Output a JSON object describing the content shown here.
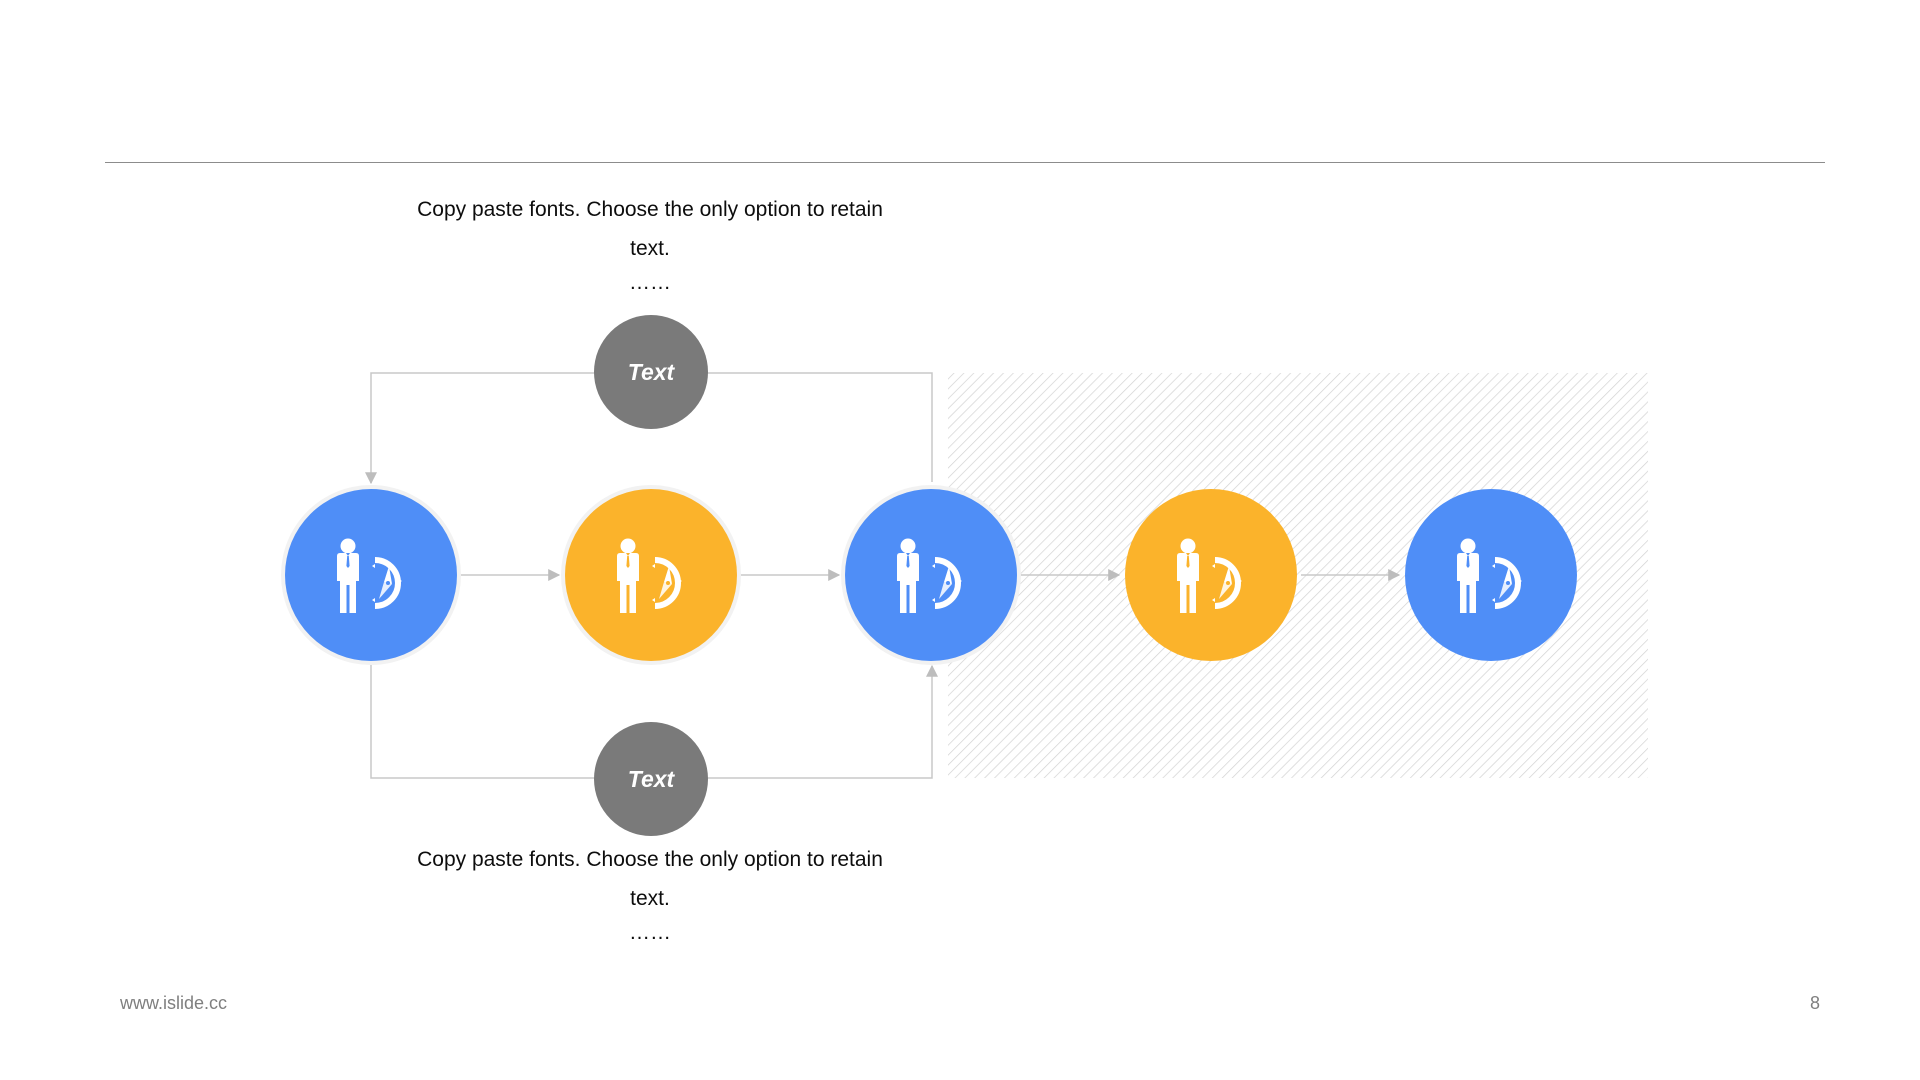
{
  "description_top": {
    "text": "Copy paste fonts. Choose the only option to retain text.",
    "dots": "……"
  },
  "description_bottom": {
    "text": "Copy paste fonts. Choose the only option to retain text.",
    "dots": "……"
  },
  "branch_labels": {
    "top": "Text",
    "bottom": "Text"
  },
  "nodes": [
    {
      "id": "node-1",
      "color": "blue",
      "icon": "person-compass-icon"
    },
    {
      "id": "node-2",
      "color": "orange",
      "icon": "person-compass-icon"
    },
    {
      "id": "node-3",
      "color": "blue",
      "icon": "person-compass-icon"
    },
    {
      "id": "node-4",
      "color": "orange",
      "icon": "person-compass-icon"
    },
    {
      "id": "node-5",
      "color": "blue",
      "icon": "person-compass-icon"
    }
  ],
  "colors": {
    "blue": "#4f8ef7",
    "orange": "#fbb32b",
    "gray_label": "#7a7a7a",
    "connector": "#c8c8c8",
    "hatch": "#d0d0d0"
  },
  "footer": {
    "url": "www.islide.cc",
    "page_number": "8"
  }
}
